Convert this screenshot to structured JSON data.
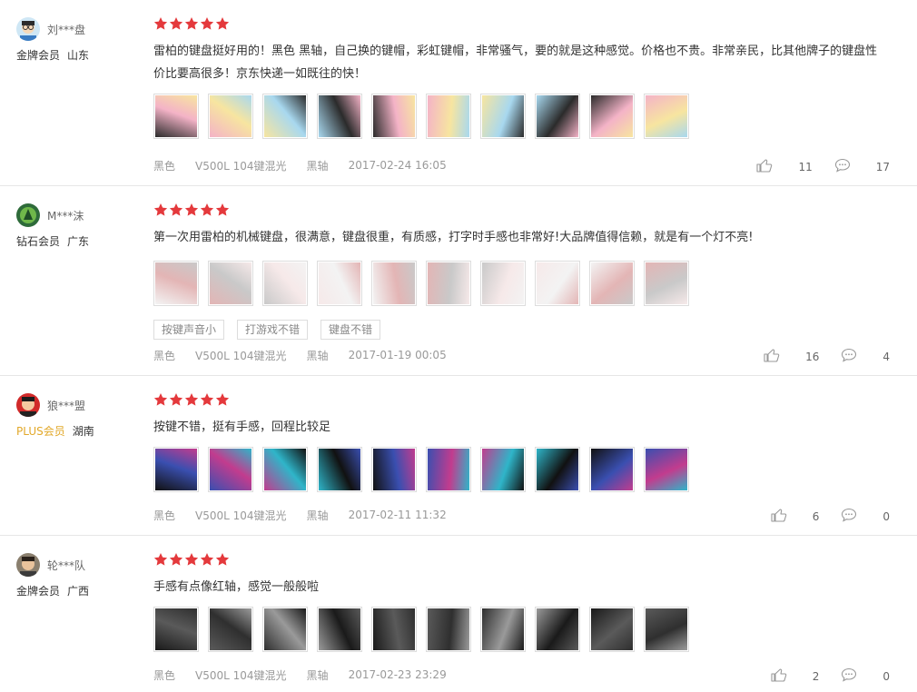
{
  "reviews": [
    {
      "user": "刘***盘",
      "level": "金牌会员",
      "location": "山东",
      "text": "雷柏的键盘挺好用的！黑色 黑轴，自己换的键帽，彩虹键帽，非常骚气，要的就是这种感觉。价格也不贵。非常亲民，比其他牌子的键盘性价比要高很多！京东快递一如既往的快！",
      "color": "黑色",
      "model": "V500L 104键混光",
      "switch": "黑轴",
      "date": "2017-02-24 16:05",
      "likes": "11",
      "comments": "17",
      "tags": []
    },
    {
      "user": "M***沫",
      "level": "钻石会员",
      "location": "广东",
      "text": "第一次用雷柏的机械键盘，很满意，键盘很重，有质感，打字时手感也非常好!大品牌值得信赖，就是有一个灯不亮!",
      "color": "黑色",
      "model": "V500L 104键混光",
      "switch": "黑轴",
      "date": "2017-01-19 00:05",
      "likes": "16",
      "comments": "4",
      "tags": [
        "按键声音小",
        "打游戏不错",
        "键盘不错"
      ]
    },
    {
      "user": "狼***盟",
      "level": "PLUS会员",
      "location": "湖南",
      "text": "按键不错，挺有手感，回程比较足",
      "color": "黑色",
      "model": "V500L 104键混光",
      "switch": "黑轴",
      "date": "2017-02-11 11:32",
      "likes": "6",
      "comments": "0",
      "tags": []
    },
    {
      "user": "轮***队",
      "level": "金牌会员",
      "location": "广西",
      "text": "手感有点像红轴，感觉一般般啦",
      "color": "黑色",
      "model": "V500L 104键混光",
      "switch": "黑轴",
      "date": "2017-02-23 23:29",
      "likes": "2",
      "comments": "0",
      "tags": []
    }
  ],
  "colors": {
    "star": "#e4393c",
    "plus_level": "#e2a829"
  }
}
